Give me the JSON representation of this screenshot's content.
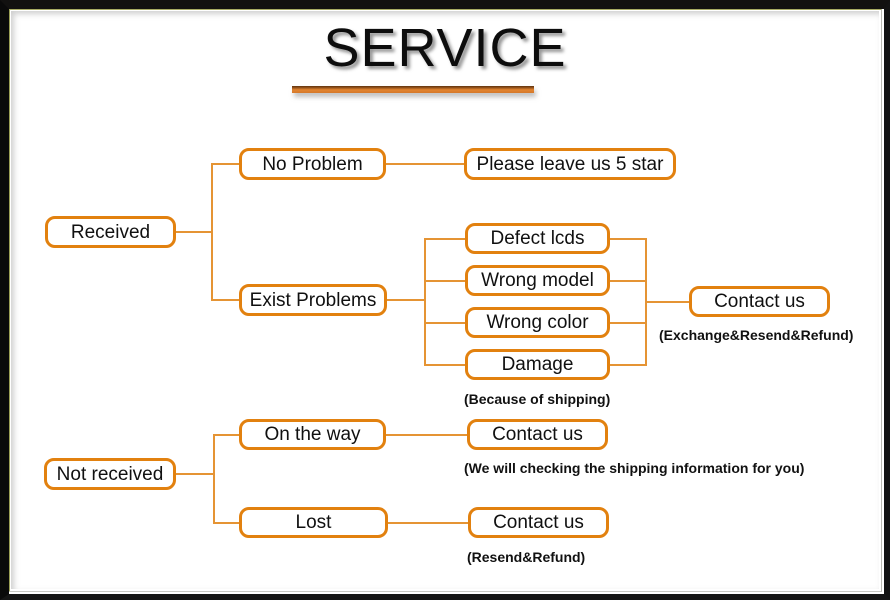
{
  "page": {
    "title": "SERVICE",
    "accent_color": "#e2810f",
    "connector_color": "#e59434",
    "frame_color": "#101010",
    "background": "#ffffff"
  },
  "nodes": {
    "received": "Received",
    "no_problem": "No Problem",
    "please_leave_5_star": "Please leave us 5 star",
    "exist_problems": "Exist Problems",
    "defect_lcds": "Defect lcds",
    "wrong_model": "Wrong model",
    "wrong_color": "Wrong color",
    "damage": "Damage",
    "contact_us_problems": "Contact us",
    "not_received": "Not received",
    "on_the_way": "On the way",
    "contact_us_on_the_way": "Contact us",
    "lost": "Lost",
    "contact_us_lost": "Contact us"
  },
  "notes": {
    "because_of_shipping": "(Because of shipping)",
    "exchange_resend_refund": "(Exchange&Resend&Refund)",
    "checking_shipping_info": "(We will checking the shipping information for you)",
    "resend_refund": "(Resend&Refund)"
  }
}
